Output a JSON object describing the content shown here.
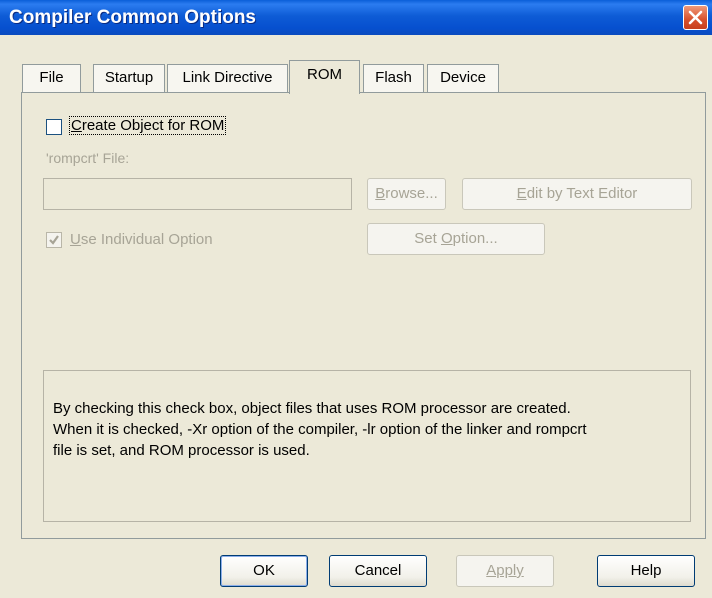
{
  "window": {
    "title": "Compiler Common Options",
    "close_icon": "close-icon"
  },
  "tabs": [
    {
      "label": "File"
    },
    {
      "label": "Startup"
    },
    {
      "label": "Link Directive"
    },
    {
      "label": "ROM",
      "active": true
    },
    {
      "label": "Flash"
    },
    {
      "label": "Device"
    }
  ],
  "rom": {
    "create_object": {
      "pre": "",
      "u": "C",
      "post": "reate Object for ROM",
      "checked": false
    },
    "rompcrt_label": {
      "pre": "'rompcrt' File:"
    },
    "rompcrt_value": "",
    "browse": {
      "u": "B",
      "post": "rowse..."
    },
    "edit": {
      "u": "E",
      "post": "dit by Text Editor"
    },
    "use_individual": {
      "u": "U",
      "post": "se Individual Option",
      "checked": true
    },
    "set_option": {
      "pre": "Set ",
      "u": "O",
      "post": "ption..."
    }
  },
  "info": {
    "lines": [
      "By checking this check box, object files that uses ROM processor are created.",
      "When it is checked, -Xr option of the compiler, -lr option of the linker and rompcrt",
      "file is set, and ROM processor is used."
    ]
  },
  "buttons": {
    "ok": "OK",
    "cancel": "Cancel",
    "apply": "Apply",
    "help": "Help"
  }
}
